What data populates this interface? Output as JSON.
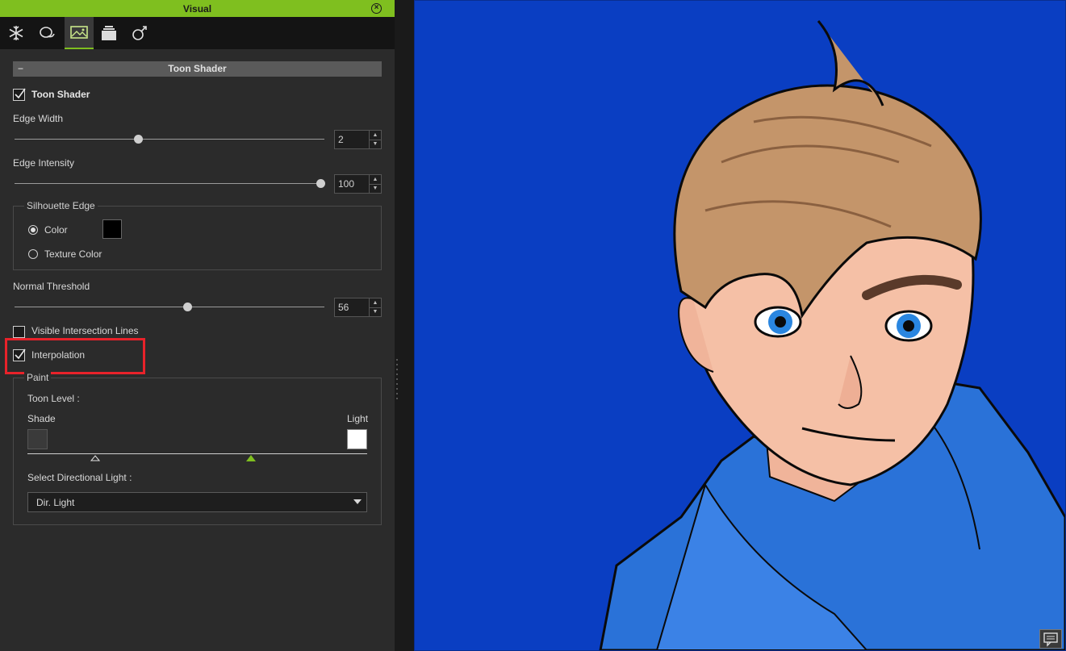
{
  "window": {
    "title": "Visual"
  },
  "tabs": [
    {
      "icon": "snowflake-icon"
    },
    {
      "icon": "lighting-icon"
    },
    {
      "icon": "image-icon",
      "active": true
    },
    {
      "icon": "layers-icon"
    },
    {
      "icon": "atom-icon"
    }
  ],
  "section": {
    "collapse_glyph": "−",
    "title": "Toon Shader"
  },
  "toon_shader": {
    "label": "Toon Shader",
    "checked": true
  },
  "edge_width": {
    "label": "Edge Width",
    "value": "2"
  },
  "edge_intensity": {
    "label": "Edge Intensity",
    "value": "100"
  },
  "silhouette": {
    "title": "Silhouette Edge",
    "color_label": "Color",
    "texture_label": "Texture Color",
    "swatch_color": "#000000"
  },
  "normal_threshold": {
    "label": "Normal Threshold",
    "value": "56"
  },
  "visible_intersection": {
    "label": "Visible Intersection Lines",
    "checked": false
  },
  "interpolation": {
    "label": "Interpolation",
    "checked": true
  },
  "paint": {
    "title": "Paint",
    "toon_level_label": "Toon Level :",
    "shade_label": "Shade",
    "light_label": "Light",
    "shade_color": "#3a3a3a",
    "light_color": "#ffffff",
    "directional_light_label": "Select Directional Light :",
    "directional_light_value": "Dir. Light"
  },
  "colors": {
    "accent": "#7fbf1f",
    "highlight": "#e8222a",
    "viewport_bg": "#0a3ec2"
  }
}
